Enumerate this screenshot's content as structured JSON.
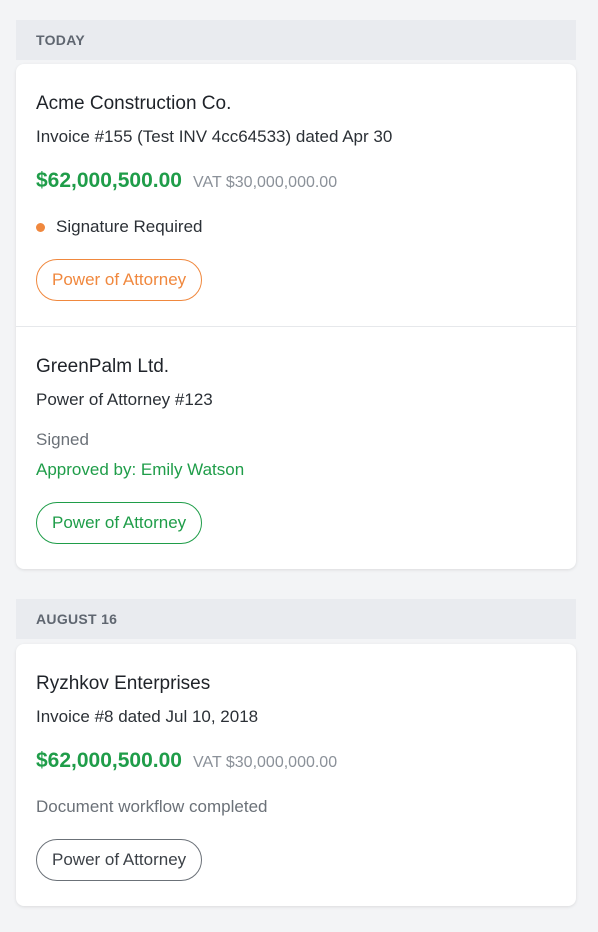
{
  "sections": [
    {
      "header": "TODAY",
      "entries": [
        {
          "company": "Acme Construction Co.",
          "description": "Invoice #155 (Test INV 4cc64533) dated Apr 30",
          "amount": "$62,000,500.00",
          "vat": "VAT $30,000,000.00",
          "status": "Signature Required",
          "status_dot_color": "#f0883e",
          "tag": "Power of Attorney",
          "tag_color": "#f0883e"
        },
        {
          "company": "GreenPalm Ltd.",
          "description": "Power of Attorney #123",
          "status": "Signed",
          "approved_by": "Approved by: Emily Watson",
          "tag": "Power of Attorney",
          "tag_color": "#1f9d49"
        }
      ]
    },
    {
      "header": "AUGUST 16",
      "entries": [
        {
          "company": "Ryzhkov Enterprises",
          "description": "Invoice #8 dated Jul 10, 2018",
          "amount": "$62,000,500.00",
          "vat": "VAT $30,000,000.00",
          "status": "Document workflow completed",
          "tag": "Power of Attorney",
          "tag_color": "#6b7178"
        }
      ]
    }
  ],
  "colors": {
    "amount": "#1f9d49",
    "background": "#f3f4f6",
    "section_header_bg": "#e9ebef"
  }
}
